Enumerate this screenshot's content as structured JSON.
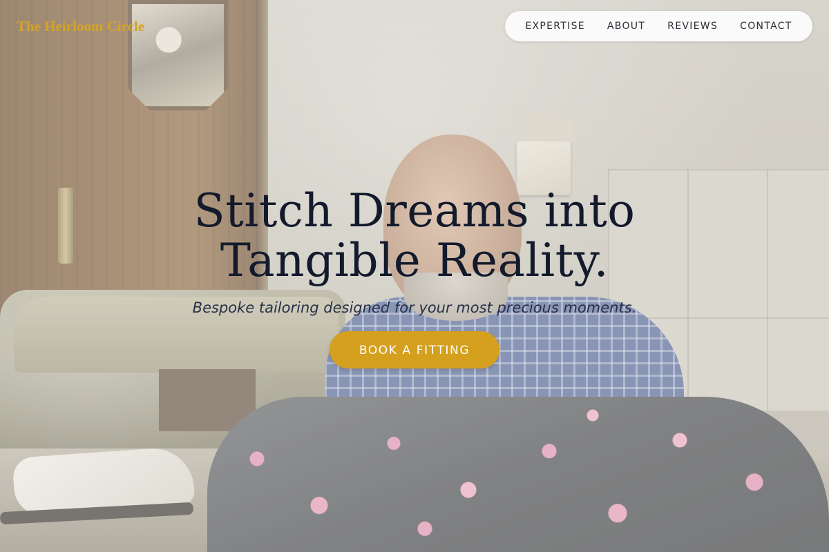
{
  "brand": {
    "name": "The Heirloom Circle",
    "color": "#d4a424"
  },
  "nav": {
    "items": [
      {
        "label": "EXPERTISE"
      },
      {
        "label": "ABOUT"
      },
      {
        "label": "REVIEWS"
      },
      {
        "label": "CONTACT"
      }
    ]
  },
  "hero": {
    "title_line_1": "Stitch Dreams into",
    "title_line_2": "Tangible Reality.",
    "subtitle": "Bespoke tailoring designed for your most precious moments.",
    "cta_label": "BOOK A FITTING",
    "cta_color": "#d4a01e",
    "background_image": "tailor-at-sewing-machine-photo"
  }
}
